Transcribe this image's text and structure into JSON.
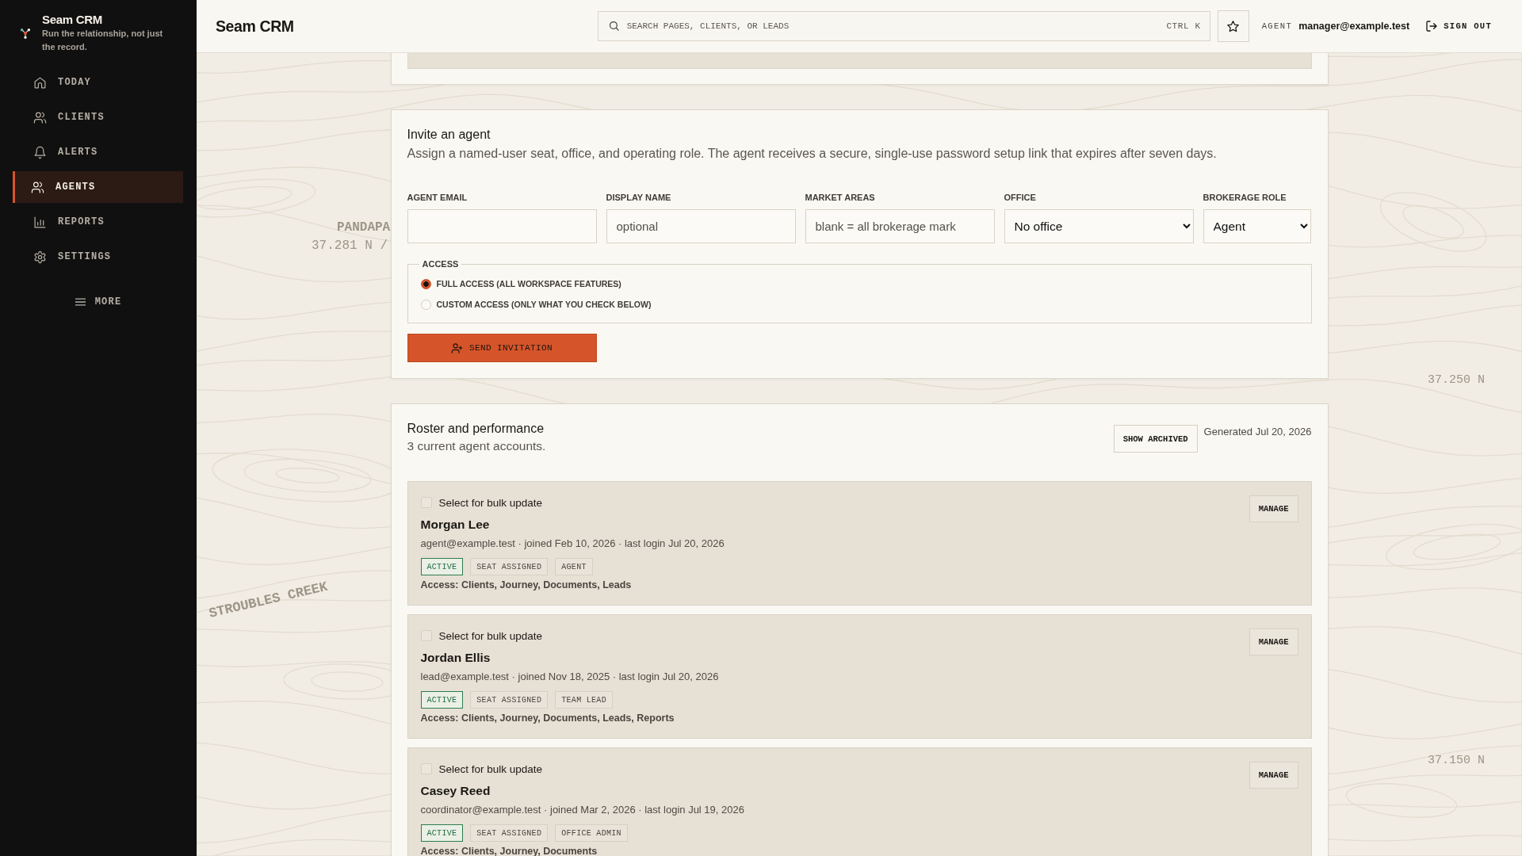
{
  "sidebar": {
    "brand": "Seam CRM",
    "tagline": "Run the relationship, not just the record.",
    "items": [
      {
        "label": "TODAY",
        "selected": false
      },
      {
        "label": "CLIENTS",
        "selected": false
      },
      {
        "label": "ALERTS",
        "selected": false
      },
      {
        "label": "AGENTS",
        "selected": true
      },
      {
        "label": "REPORTS",
        "selected": false
      },
      {
        "label": "SETTINGS",
        "selected": false
      }
    ],
    "more": "MORE"
  },
  "topbar": {
    "title": "Seam CRM",
    "search": {
      "placeholder": "SEARCH PAGES, CLIENTS, OR LEADS",
      "shortcut": "CTRL K"
    },
    "user_role": "AGENT",
    "user_email": "manager@example.test",
    "sign_out": "SIGN OUT"
  },
  "invite": {
    "title": "Invite an agent",
    "description": "Assign a named-user seat, office, and operating role. The agent receives a secure, single-use password setup link that expires after seven days.",
    "fields": [
      {
        "kind": "input",
        "label": "AGENT EMAIL"
      },
      {
        "kind": "input",
        "label": "DISPLAY NAME",
        "placeholder": "optional"
      },
      {
        "kind": "input",
        "label": "MARKET AREAS",
        "placeholder": "blank = all brokerage mark"
      },
      {
        "kind": "select",
        "label": "OFFICE",
        "value": "No office"
      },
      {
        "kind": "select",
        "label": "BROKERAGE ROLE",
        "value": "Agent"
      }
    ],
    "access": {
      "legend": "ACCESS",
      "options": [
        {
          "label": "FULL ACCESS (ALL WORKSPACE FEATURES)",
          "selected": true
        },
        {
          "label": "CUSTOM ACCESS (ONLY WHAT YOU CHECK BELOW)",
          "selected": false
        }
      ]
    },
    "submit": "SEND INVITATION"
  },
  "roster": {
    "title": "Roster and performance",
    "subtitle": "3 current agent accounts.",
    "show_archived": "SHOW ARCHIVED",
    "generated": "Generated Jul 20, 2026",
    "agents": [
      {
        "select_label": "Select for bulk update",
        "selected": false,
        "name": "Morgan Lee",
        "meta": "agent@example.test · joined Feb 10, 2026 · last login Jul 20, 2026",
        "tags": [
          {
            "kind": "status",
            "label": "ACTIVE"
          },
          {
            "kind": "tag",
            "label": "SEAT ASSIGNED"
          },
          {
            "kind": "tag",
            "label": "AGENT"
          }
        ],
        "access": "Access: Clients, Journey, Documents, Leads",
        "manage": "MANAGE"
      },
      {
        "select_label": "Select for bulk update",
        "selected": false,
        "name": "Jordan Ellis",
        "meta": "lead@example.test · joined Nov 18, 2025 · last login Jul 20, 2026",
        "tags": [
          {
            "kind": "status",
            "label": "ACTIVE"
          },
          {
            "kind": "tag",
            "label": "SEAT ASSIGNED"
          },
          {
            "kind": "tag",
            "label": "TEAM LEAD"
          }
        ],
        "access": "Access: Clients, Journey, Documents, Leads, Reports",
        "manage": "MANAGE"
      },
      {
        "select_label": "Select for bulk update",
        "selected": false,
        "name": "Casey Reed",
        "meta": "coordinator@example.test · joined Mar 2, 2026 · last login Jul 19, 2026",
        "tags": [
          {
            "kind": "status",
            "label": "ACTIVE"
          },
          {
            "kind": "tag",
            "label": "SEAT ASSIGNED"
          },
          {
            "kind": "tag",
            "label": "OFFICE ADMIN"
          }
        ],
        "access": "Access: Clients, Journey, Documents",
        "manage": "MANAGE"
      }
    ]
  },
  "background": {
    "map_labels": [
      "PANDAPA",
      "37.281 N /",
      "STROUBLES CREEK",
      "37.250 N",
      "37.150 N"
    ]
  }
}
